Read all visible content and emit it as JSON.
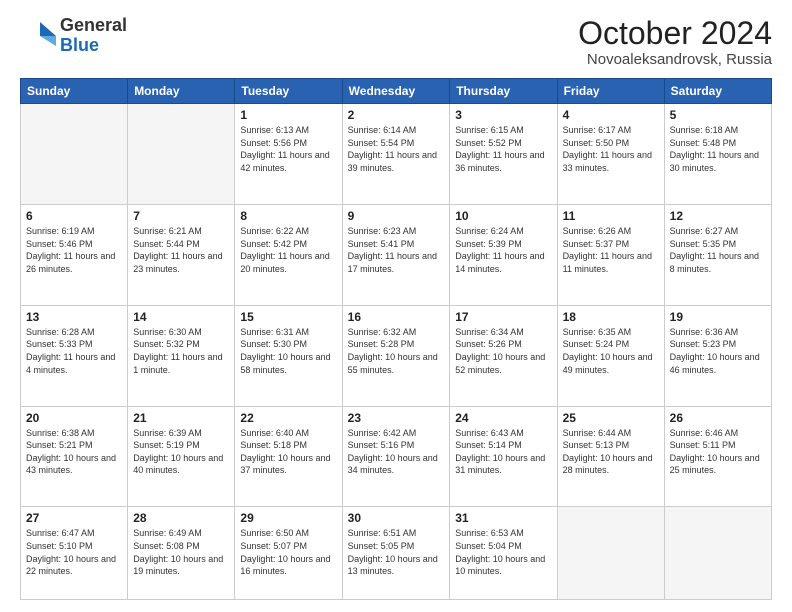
{
  "logo": {
    "general": "General",
    "blue": "Blue"
  },
  "header": {
    "month": "October 2024",
    "location": "Novoaleksandrovsk, Russia"
  },
  "days_of_week": [
    "Sunday",
    "Monday",
    "Tuesday",
    "Wednesday",
    "Thursday",
    "Friday",
    "Saturday"
  ],
  "weeks": [
    [
      {
        "day": "",
        "info": ""
      },
      {
        "day": "",
        "info": ""
      },
      {
        "day": "1",
        "info": "Sunrise: 6:13 AM\nSunset: 5:56 PM\nDaylight: 11 hours and 42 minutes."
      },
      {
        "day": "2",
        "info": "Sunrise: 6:14 AM\nSunset: 5:54 PM\nDaylight: 11 hours and 39 minutes."
      },
      {
        "day": "3",
        "info": "Sunrise: 6:15 AM\nSunset: 5:52 PM\nDaylight: 11 hours and 36 minutes."
      },
      {
        "day": "4",
        "info": "Sunrise: 6:17 AM\nSunset: 5:50 PM\nDaylight: 11 hours and 33 minutes."
      },
      {
        "day": "5",
        "info": "Sunrise: 6:18 AM\nSunset: 5:48 PM\nDaylight: 11 hours and 30 minutes."
      }
    ],
    [
      {
        "day": "6",
        "info": "Sunrise: 6:19 AM\nSunset: 5:46 PM\nDaylight: 11 hours and 26 minutes."
      },
      {
        "day": "7",
        "info": "Sunrise: 6:21 AM\nSunset: 5:44 PM\nDaylight: 11 hours and 23 minutes."
      },
      {
        "day": "8",
        "info": "Sunrise: 6:22 AM\nSunset: 5:42 PM\nDaylight: 11 hours and 20 minutes."
      },
      {
        "day": "9",
        "info": "Sunrise: 6:23 AM\nSunset: 5:41 PM\nDaylight: 11 hours and 17 minutes."
      },
      {
        "day": "10",
        "info": "Sunrise: 6:24 AM\nSunset: 5:39 PM\nDaylight: 11 hours and 14 minutes."
      },
      {
        "day": "11",
        "info": "Sunrise: 6:26 AM\nSunset: 5:37 PM\nDaylight: 11 hours and 11 minutes."
      },
      {
        "day": "12",
        "info": "Sunrise: 6:27 AM\nSunset: 5:35 PM\nDaylight: 11 hours and 8 minutes."
      }
    ],
    [
      {
        "day": "13",
        "info": "Sunrise: 6:28 AM\nSunset: 5:33 PM\nDaylight: 11 hours and 4 minutes."
      },
      {
        "day": "14",
        "info": "Sunrise: 6:30 AM\nSunset: 5:32 PM\nDaylight: 11 hours and 1 minute."
      },
      {
        "day": "15",
        "info": "Sunrise: 6:31 AM\nSunset: 5:30 PM\nDaylight: 10 hours and 58 minutes."
      },
      {
        "day": "16",
        "info": "Sunrise: 6:32 AM\nSunset: 5:28 PM\nDaylight: 10 hours and 55 minutes."
      },
      {
        "day": "17",
        "info": "Sunrise: 6:34 AM\nSunset: 5:26 PM\nDaylight: 10 hours and 52 minutes."
      },
      {
        "day": "18",
        "info": "Sunrise: 6:35 AM\nSunset: 5:24 PM\nDaylight: 10 hours and 49 minutes."
      },
      {
        "day": "19",
        "info": "Sunrise: 6:36 AM\nSunset: 5:23 PM\nDaylight: 10 hours and 46 minutes."
      }
    ],
    [
      {
        "day": "20",
        "info": "Sunrise: 6:38 AM\nSunset: 5:21 PM\nDaylight: 10 hours and 43 minutes."
      },
      {
        "day": "21",
        "info": "Sunrise: 6:39 AM\nSunset: 5:19 PM\nDaylight: 10 hours and 40 minutes."
      },
      {
        "day": "22",
        "info": "Sunrise: 6:40 AM\nSunset: 5:18 PM\nDaylight: 10 hours and 37 minutes."
      },
      {
        "day": "23",
        "info": "Sunrise: 6:42 AM\nSunset: 5:16 PM\nDaylight: 10 hours and 34 minutes."
      },
      {
        "day": "24",
        "info": "Sunrise: 6:43 AM\nSunset: 5:14 PM\nDaylight: 10 hours and 31 minutes."
      },
      {
        "day": "25",
        "info": "Sunrise: 6:44 AM\nSunset: 5:13 PM\nDaylight: 10 hours and 28 minutes."
      },
      {
        "day": "26",
        "info": "Sunrise: 6:46 AM\nSunset: 5:11 PM\nDaylight: 10 hours and 25 minutes."
      }
    ],
    [
      {
        "day": "27",
        "info": "Sunrise: 6:47 AM\nSunset: 5:10 PM\nDaylight: 10 hours and 22 minutes."
      },
      {
        "day": "28",
        "info": "Sunrise: 6:49 AM\nSunset: 5:08 PM\nDaylight: 10 hours and 19 minutes."
      },
      {
        "day": "29",
        "info": "Sunrise: 6:50 AM\nSunset: 5:07 PM\nDaylight: 10 hours and 16 minutes."
      },
      {
        "day": "30",
        "info": "Sunrise: 6:51 AM\nSunset: 5:05 PM\nDaylight: 10 hours and 13 minutes."
      },
      {
        "day": "31",
        "info": "Sunrise: 6:53 AM\nSunset: 5:04 PM\nDaylight: 10 hours and 10 minutes."
      },
      {
        "day": "",
        "info": ""
      },
      {
        "day": "",
        "info": ""
      }
    ]
  ]
}
